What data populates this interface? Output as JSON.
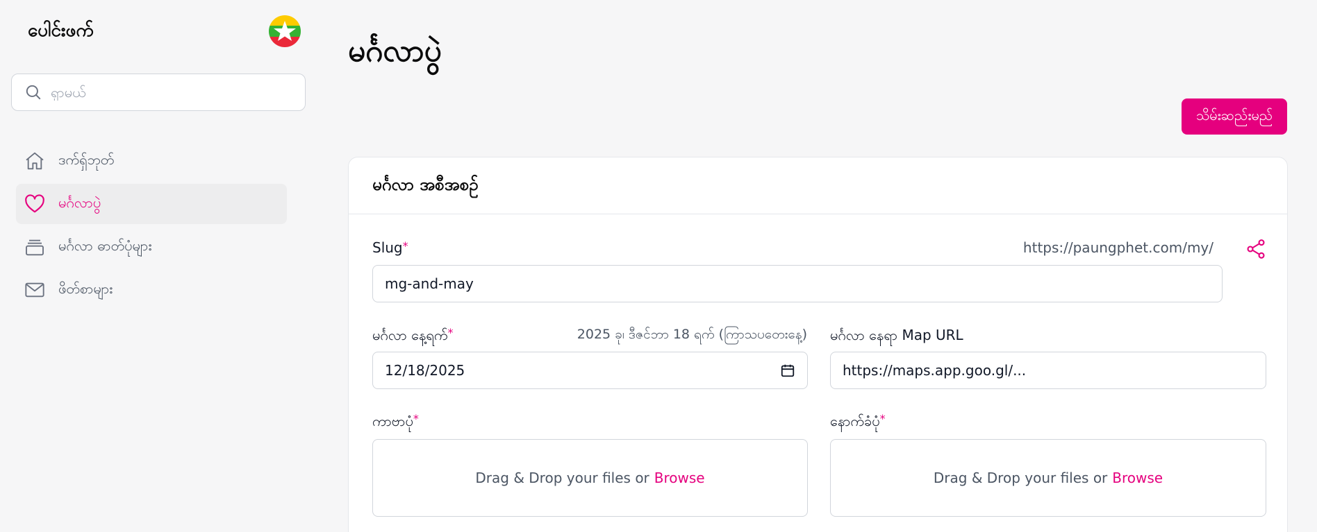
{
  "app": {
    "brand": "ပေါင်းဖက်"
  },
  "search": {
    "placeholder": "ရှာမယ်"
  },
  "sidebar": {
    "items": [
      {
        "label": "ဒက်ရှ်ဘုတ်",
        "icon": "home-icon",
        "active": false
      },
      {
        "label": "မင်္ဂလာပွဲ",
        "icon": "heart-icon",
        "active": true
      },
      {
        "label": "မင်္ဂလာ ဓာတ်ပုံများ",
        "icon": "album-icon",
        "active": false
      },
      {
        "label": "ဖိတ်စာများ",
        "icon": "mail-icon",
        "active": false
      }
    ]
  },
  "page": {
    "title": "မင်္ဂလာပွဲ",
    "save_label": "သိမ်းဆည်းမည်"
  },
  "card": {
    "title": "မင်္ဂလာ အစီအစဉ်",
    "slug": {
      "label": "Slug",
      "prefix": "https://paungphet.com/my/",
      "value": "mg-and-may"
    },
    "date": {
      "label": "မင်္ဂလာ နေ့ရက်",
      "hint": "2025 ခု၊ ဒီဇင်ဘာ 18 ရက် (ကြာသပတေးနေ့)",
      "value": "12/18/2025"
    },
    "map": {
      "label": "မင်္ဂလာ နေရာ Map URL",
      "value": "https://maps.app.goo.gl/..."
    },
    "cover": {
      "label": "ကာဗာပုံ",
      "drop_text": "Drag & Drop your files or",
      "browse": "Browse"
    },
    "background": {
      "label": "နောက်ခံပုံ",
      "drop_text": "Drag & Drop your files or",
      "browse": "Browse"
    }
  },
  "colors": {
    "accent": "#e5007e",
    "background": "#f6f6f7"
  }
}
